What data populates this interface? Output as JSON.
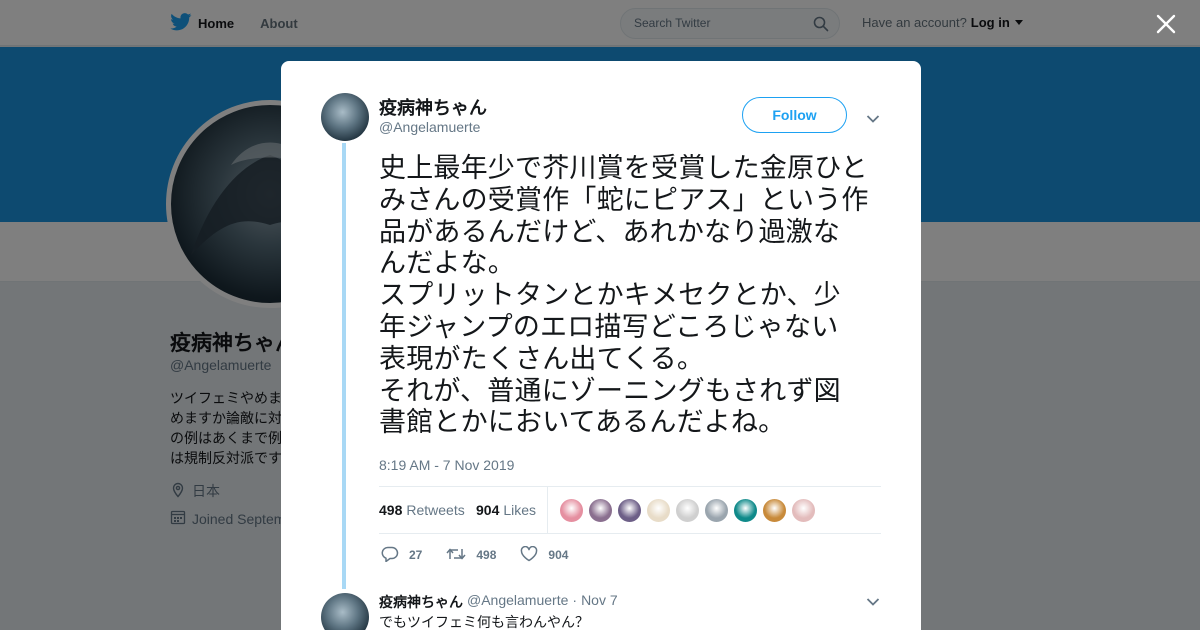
{
  "nav": {
    "home_label": "Home",
    "about_label": "About",
    "search_placeholder": "Search Twitter",
    "account_prompt": "Have an account?",
    "login_label": "Log in"
  },
  "profile": {
    "name": "疫病神ちゃん",
    "handle": "@Angelamuerte",
    "bio_lines": [
      "ツイフェミやめま",
      "めますか論敵に対",
      "の例はあくまで例",
      "は規制反対派です"
    ],
    "location": "日本",
    "joined": "Joined September"
  },
  "tweet": {
    "author_name": "疫病神ちゃん",
    "author_handle": "@Angelamuerte",
    "follow_label": "Follow",
    "text_lines": [
      "史上最年少で芥川賞を受賞した金原ひと",
      "みさんの受賞作「蛇にピアス」という作",
      "品があるんだけど、あれかなり過激な",
      "んだよな。",
      "スプリットタンとかキメセクとか、少",
      "年ジャンプのエロ描写どころじゃない",
      "表現がたくさん出てくる。",
      "それが、普通にゾーニングもされず図",
      "書館とかにおいてあるんだよね。"
    ],
    "timestamp": "8:19 AM - 7 Nov 2019",
    "retweets_count": "498",
    "retweets_label": "Retweets",
    "likes_count": "904",
    "likes_label": "Likes",
    "reply_count": "27",
    "retweet_action_count": "498",
    "like_action_count": "904",
    "liker_avatar_colors": [
      "#e58fa0",
      "#8a6f8f",
      "#6d5f87",
      "#e8dcc8",
      "#cfcfcf",
      "#9aa5ae",
      "#0f8a8a",
      "#c88a3a",
      "#e3bcbc"
    ]
  },
  "reply": {
    "name": "疫病神ちゃん",
    "handle": "@Angelamuerte",
    "separator": "·",
    "date": "Nov 7",
    "text": "でもツイフェミ何も言わんやん？"
  },
  "colors": {
    "accent": "#1da1f2",
    "banner": "#1b95e0",
    "thread_line": "#a8d8f5"
  }
}
